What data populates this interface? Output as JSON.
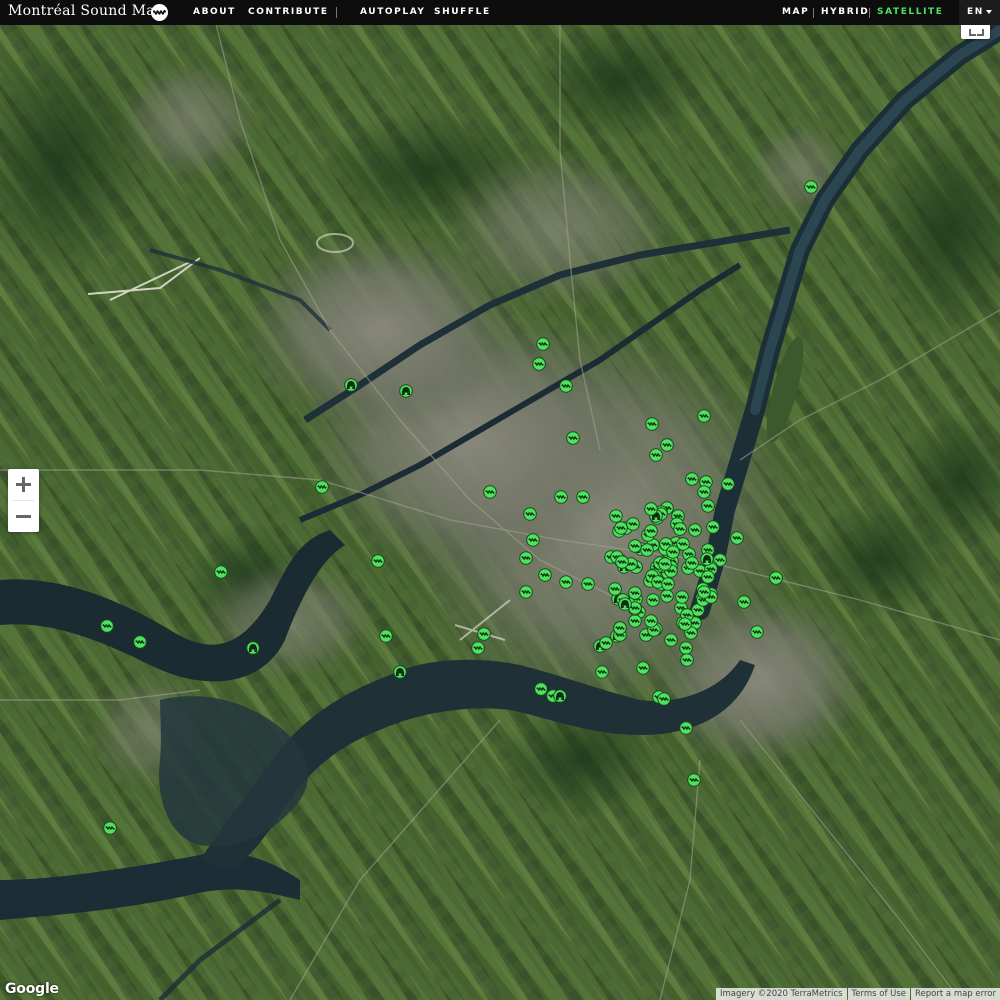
{
  "header": {
    "brand": "Montréal Sound Map",
    "logo_icon": "waveform-logo-icon",
    "nav": {
      "about": "ABOUT",
      "contribute": "CONTRIBUTE",
      "autoplay": "AUTOPLAY",
      "shuffle": "SHUFFLE"
    },
    "map_types": {
      "map": "MAP",
      "hybrid": "HYBRID",
      "satellite": "SATELLITE",
      "selected": "SATELLITE"
    },
    "language": "EN"
  },
  "colors": {
    "marker": "#4ee25e",
    "active_nav": "#4ee25e",
    "topbar": "#0d0d0d"
  },
  "controls": {
    "zoom_in": "+",
    "zoom_out": "−",
    "fullscreen_icon": "fullscreen-icon"
  },
  "map": {
    "imagery": "satellite",
    "marker_icons": [
      "waveform-marker-icon",
      "headphones-marker-icon"
    ]
  },
  "footer": {
    "google": "Google",
    "imagery_credit": "Imagery ©2020 TerraMetrics",
    "terms": "Terms of Use",
    "report": "Report a map error"
  }
}
